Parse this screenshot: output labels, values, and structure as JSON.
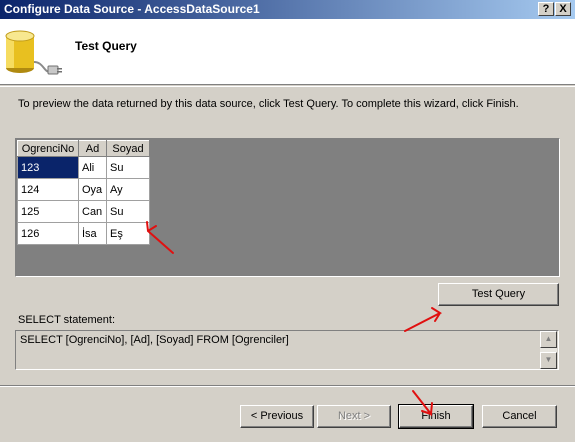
{
  "window": {
    "title": "Configure Data Source - AccessDataSource1",
    "help_label": "?",
    "close_label": "X"
  },
  "header": {
    "title": "Test Query"
  },
  "instructions": "To preview the data returned by this data source, click Test Query. To complete this wizard, click Finish.",
  "grid": {
    "columns": [
      "OgrenciNo",
      "Ad",
      "Soyad"
    ],
    "rows": [
      [
        "123",
        "Ali",
        "Su"
      ],
      [
        "124",
        "Oya",
        "Ay"
      ],
      [
        "125",
        "Can",
        "Su"
      ],
      [
        "126",
        "İsa",
        "Eş"
      ]
    ]
  },
  "buttons": {
    "test_query": "Test Query",
    "previous": "< Previous",
    "next": "Next >",
    "finish": "Finish",
    "cancel": "Cancel"
  },
  "select": {
    "label": "SELECT statement:",
    "statement": "SELECT [OgrenciNo], [Ad], [Soyad] FROM [Ogrenciler]"
  },
  "colors": {
    "dialog_bg": "#d4d0c8",
    "title_start": "#0a246a",
    "title_end": "#a6caf0",
    "grid_bg": "#808080",
    "selection": "#0a246a",
    "annotation_red": "#e01010"
  },
  "icons": {
    "header": "database-connection-icon",
    "scroll_up": "scroll-up-arrow-icon",
    "scroll_down": "scroll-down-arrow-icon"
  }
}
